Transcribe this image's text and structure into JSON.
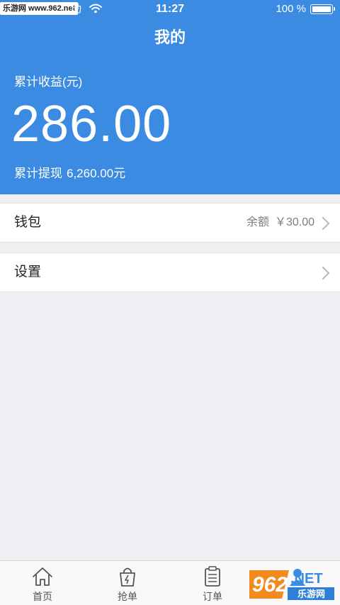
{
  "status_bar": {
    "watermark": "乐游网 www.962.net",
    "carrier": "动",
    "time": "11:27",
    "battery": "100 %"
  },
  "header": {
    "title": "我的",
    "earnings_label": "累计收益(元)",
    "earnings_value": "286.00",
    "withdraw_label": "累计提现",
    "withdraw_value": "6,260.00元"
  },
  "wallet": {
    "label": "钱包",
    "balance_label": "余额",
    "balance_value": "￥30.00"
  },
  "settings": {
    "label": "设置"
  },
  "tabbar": {
    "home": "首页",
    "grab": "抢单",
    "orders": "订单"
  },
  "logo": {
    "text": "962.NET",
    "subtext": "乐游网"
  },
  "colors": {
    "header_bg": "#3b8be3",
    "page_bg": "#efeff4"
  }
}
